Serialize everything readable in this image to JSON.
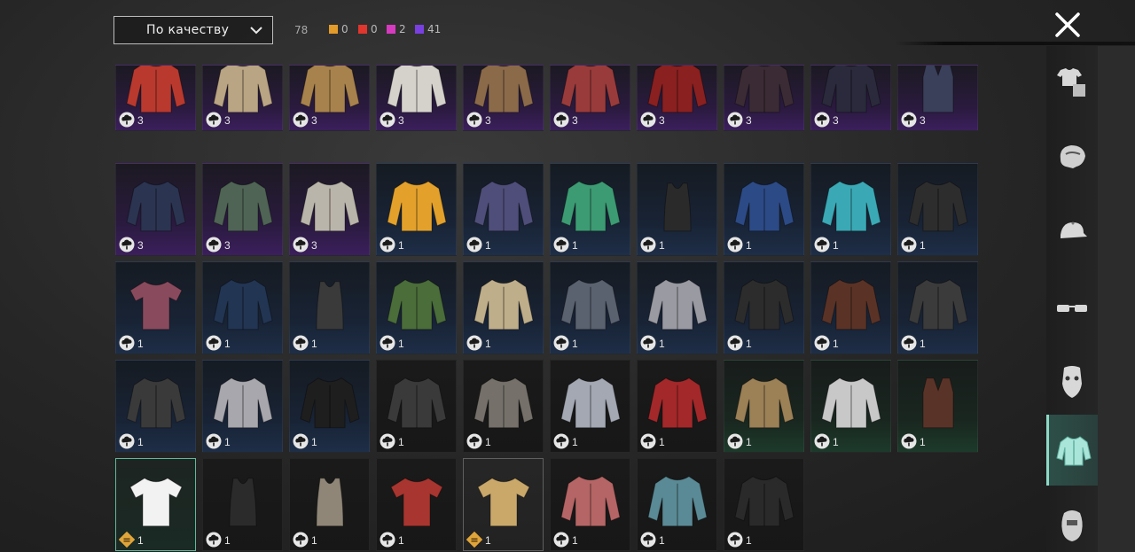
{
  "sort": {
    "label": "По качеству"
  },
  "counts": {
    "total": "78",
    "rarities": [
      {
        "color": "#e39b2a",
        "value": "0"
      },
      {
        "color": "#e0362d",
        "value": "0"
      },
      {
        "color": "#d63bbf",
        "value": "2"
      },
      {
        "color": "#7a3fe0",
        "value": "41"
      }
    ]
  },
  "items": [
    {
      "rarity": "epic",
      "qty": "3",
      "color": "#b9392f",
      "icon": "red-white-jacket-icon"
    },
    {
      "rarity": "epic",
      "qty": "3",
      "color": "#b9a483",
      "icon": "beige-trench-jacket-icon"
    },
    {
      "rarity": "epic",
      "qty": "3",
      "color": "#a8824c",
      "icon": "tan-leather-jacket-icon"
    },
    {
      "rarity": "epic",
      "qty": "3",
      "color": "#d5d2cc",
      "icon": "white-blouse-icon"
    },
    {
      "rarity": "epic",
      "qty": "3",
      "color": "#8b6a4a",
      "icon": "plaid-shirt-icon"
    },
    {
      "rarity": "epic",
      "qty": "3",
      "color": "#9a3b3b",
      "icon": "floral-shirt-icon"
    },
    {
      "rarity": "epic",
      "qty": "3",
      "color": "#8a2020",
      "icon": "red-black-coat-icon"
    },
    {
      "rarity": "epic",
      "qty": "3",
      "color": "#3b2b35",
      "icon": "dark-top-icon"
    },
    {
      "rarity": "epic",
      "qty": "3",
      "color": "#2a2a3c",
      "icon": "navy-sailor-jacket-icon"
    },
    {
      "rarity": "epic",
      "qty": "3",
      "color": "#3a3f5a",
      "icon": "school-vest-icon"
    },
    {
      "rarity": "epic",
      "qty": "3",
      "color": "#2b3450",
      "icon": "sweater-vest-icon"
    },
    {
      "rarity": "epic",
      "qty": "3",
      "color": "#4f6454",
      "icon": "green-sweater-icon"
    },
    {
      "rarity": "epic",
      "qty": "3",
      "color": "#bab5aa",
      "icon": "cream-blazer-icon"
    },
    {
      "rarity": "rare",
      "qty": "1",
      "color": "#e3a12b",
      "icon": "yellow-jacket-icon"
    },
    {
      "rarity": "rare",
      "qty": "1",
      "color": "#4f4e7a",
      "icon": "purple-track-jacket-icon"
    },
    {
      "rarity": "rare",
      "qty": "1",
      "color": "#3c9b73",
      "icon": "tropical-shirt-icon"
    },
    {
      "rarity": "rare",
      "qty": "1",
      "color": "#2a2a2a",
      "icon": "black-tank-icon"
    },
    {
      "rarity": "rare",
      "qty": "1",
      "color": "#2c4a86",
      "icon": "blue-varsity-jacket-icon"
    },
    {
      "rarity": "rare",
      "qty": "1",
      "color": "#3aa9b5",
      "icon": "teal-hoodie-icon"
    },
    {
      "rarity": "rare",
      "qty": "1",
      "color": "#2d2d2d",
      "icon": "black-leather-jacket-icon"
    },
    {
      "rarity": "rare",
      "qty": "1",
      "color": "#8a4a5e",
      "icon": "maroon-tee-icon"
    },
    {
      "rarity": "rare",
      "qty": "1",
      "color": "#223553",
      "icon": "navy-plaid-shirt-icon"
    },
    {
      "rarity": "rare",
      "qty": "1",
      "color": "#3a3a3a",
      "icon": "graphic-tank-icon"
    },
    {
      "rarity": "rare",
      "qty": "1",
      "color": "#4a6d3a",
      "icon": "green-vest-shirt-icon"
    },
    {
      "rarity": "rare",
      "qty": "1",
      "color": "#bfae8a",
      "icon": "camo-shirt-icon"
    },
    {
      "rarity": "rare",
      "qty": "1",
      "color": "#5a6270",
      "icon": "grey-raglan-icon"
    },
    {
      "rarity": "rare",
      "qty": "1",
      "color": "#9a9aa3",
      "icon": "grey-longsleeve-icon"
    },
    {
      "rarity": "rare",
      "qty": "1",
      "color": "#2c2c2c",
      "icon": "black-longsleeve-icon"
    },
    {
      "rarity": "rare",
      "qty": "1",
      "color": "#5a3326",
      "icon": "brown-leather-jacket-icon"
    },
    {
      "rarity": "rare",
      "qty": "1",
      "color": "#3b3b3b",
      "icon": "dark-hooded-jacket-icon"
    },
    {
      "rarity": "rare",
      "qty": "1",
      "color": "#3a3a3a",
      "icon": "quilted-jacket-icon"
    },
    {
      "rarity": "rare",
      "qty": "1",
      "color": "#a7a7ad",
      "icon": "grey-hooded-jacket-icon"
    },
    {
      "rarity": "rare",
      "qty": "1",
      "color": "#1e1e1e",
      "icon": "black-blazer-icon"
    },
    {
      "rarity": "common",
      "qty": "1",
      "color": "#3a3a3a",
      "icon": "dark-buttonup-icon"
    },
    {
      "rarity": "common",
      "qty": "1",
      "color": "#75716a",
      "icon": "grey-buttonup-icon"
    },
    {
      "rarity": "common",
      "qty": "1",
      "color": "#a3a8b3",
      "icon": "check-shirt-icon"
    },
    {
      "rarity": "common",
      "qty": "1",
      "color": "#a3282a",
      "icon": "red-plaid-shirt-icon"
    },
    {
      "rarity": "uncommon",
      "qty": "1",
      "color": "#9c8056",
      "icon": "tan-hooded-jacket-icon"
    },
    {
      "rarity": "uncommon",
      "qty": "1",
      "color": "#c8c8c8",
      "icon": "white-dress-shirt-icon"
    },
    {
      "rarity": "uncommon",
      "qty": "1",
      "color": "#5a3328",
      "icon": "brown-vest-icon"
    },
    {
      "rarity": "selected",
      "qty": "1",
      "color": "#f2f2f2",
      "icon": "white-tee-icon",
      "badge": "gold"
    },
    {
      "rarity": "common",
      "qty": "1",
      "color": "#2b2b2b",
      "icon": "black-tank-top-icon"
    },
    {
      "rarity": "common",
      "qty": "1",
      "color": "#8f8678",
      "icon": "beige-tank-top-icon"
    },
    {
      "rarity": "common",
      "qty": "1",
      "color": "#a8352f",
      "icon": "red-tee-icon"
    },
    {
      "rarity": "highlight",
      "qty": "1",
      "color": "#c9a86a",
      "icon": "striped-tee-icon",
      "badge": "gold"
    },
    {
      "rarity": "common",
      "qty": "1",
      "color": "#b56565",
      "icon": "red-striped-longsleeve-icon"
    },
    {
      "rarity": "common",
      "qty": "1",
      "color": "#5a8a95",
      "icon": "blue-longsleeve-icon"
    },
    {
      "rarity": "common",
      "qty": "1",
      "color": "#2a2a2a",
      "icon": "black-longsleeve-tee-icon"
    }
  ],
  "categories": [
    {
      "icon": "outfit-icon",
      "active": false
    },
    {
      "icon": "hair-icon",
      "active": false
    },
    {
      "icon": "cap-icon",
      "active": false
    },
    {
      "icon": "glasses-icon",
      "active": false
    },
    {
      "icon": "face-mask-icon",
      "active": false
    },
    {
      "icon": "shirt-icon",
      "active": true
    },
    {
      "icon": "head-icon",
      "active": false
    }
  ]
}
